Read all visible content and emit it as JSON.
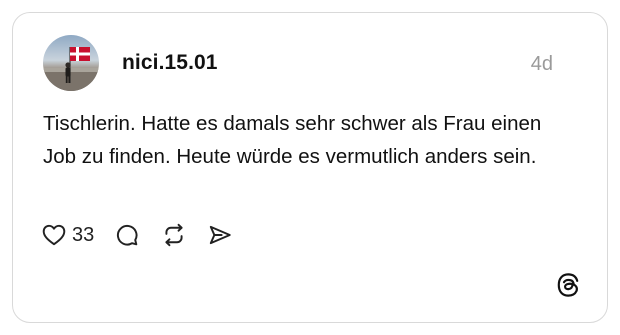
{
  "post": {
    "username": "nici.15.01",
    "timestamp": "4d",
    "text": "Tischlerin. Hatte es damals sehr schwer als Frau einen Job zu finden. Heute würde es vermutlich anders sein.",
    "like_count": "33"
  },
  "icons": {
    "like": "heart-icon",
    "reply": "comment-icon",
    "repost": "repost-icon",
    "share": "send-icon",
    "brand": "threads-logo-icon"
  },
  "colors": {
    "text": "#111111",
    "timestamp": "#9a9a9a",
    "border": "#d9d9d9",
    "flag_red": "#c8102e"
  }
}
